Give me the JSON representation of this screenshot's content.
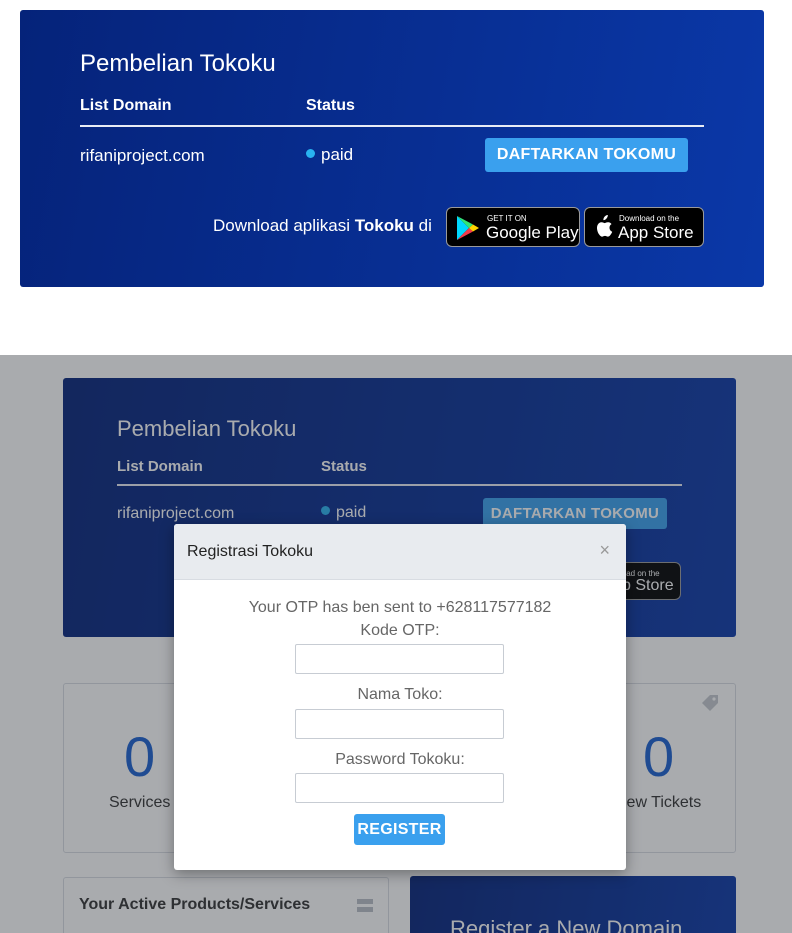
{
  "top": {
    "title": "Pembelian Tokoku",
    "col_domain": "List Domain",
    "col_status": "Status",
    "domain": "rifaniproject.com",
    "status": "paid",
    "register_button": "DAFTARKAN TOKOMU",
    "download_prefix": "Download aplikasi ",
    "download_brand": "Tokoku",
    "download_suffix": " di",
    "google_small": "GET IT ON",
    "google_big": "Google Play",
    "apple_small": "Download on the",
    "apple_big": "App Store"
  },
  "bottom": {
    "title": "Pembelian Tokoku",
    "col_domain": "List Domain",
    "col_status": "Status",
    "domain": "rifaniproject.com",
    "status": "paid",
    "register_button": "DAFTARKAN TOKOMU",
    "apple_small_partial": "load on the",
    "apple_big_partial": "p Store",
    "stats": [
      {
        "value": "0",
        "label": "Services"
      },
      {
        "value": "0",
        "label": "iew Tickets"
      }
    ],
    "active_products_title": "Your Active Products/Services",
    "register_domain_title": "Register a New Domain"
  },
  "modal": {
    "title": "Registrasi Tokoku",
    "close": "×",
    "otp_message": "Your OTP has ben sent to +628117577182",
    "otp_label": "Kode OTP:",
    "otp_value": "",
    "store_label": "Nama Toko:",
    "store_value": "",
    "password_label": "Password Tokoku:",
    "password_value": "",
    "submit": "REGISTER"
  },
  "colors": {
    "card_gradient_start": "#05237a",
    "card_gradient_end": "#0a38a8",
    "accent_button": "#3aa0ee",
    "status_dot": "#29b3f0",
    "stat_number": "#1a5fd0"
  }
}
